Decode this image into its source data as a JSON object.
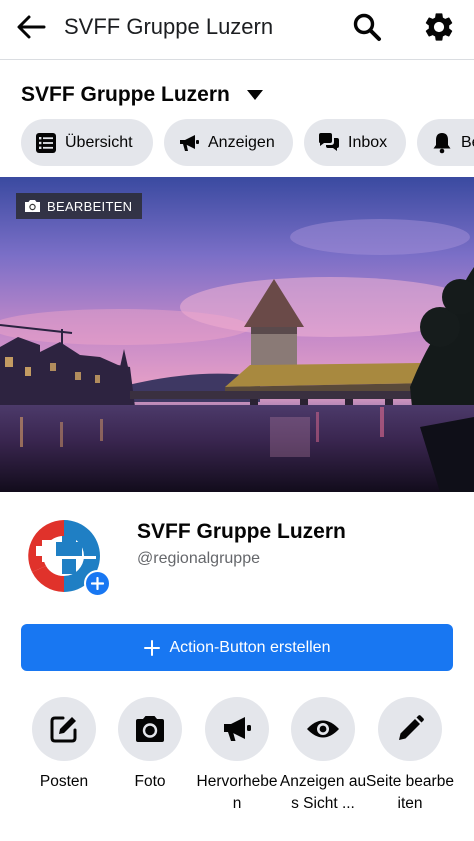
{
  "header": {
    "title": "SVFF Gruppe Luzern",
    "back_icon": "back-arrow-icon",
    "search_icon": "search-icon",
    "settings_icon": "gear-icon"
  },
  "page_switcher": {
    "name": "SVFF Gruppe Luzern",
    "icon": "caret-down-icon"
  },
  "tabs": [
    {
      "label": "Übersicht",
      "icon": "list-icon"
    },
    {
      "label": "Anzeigen",
      "icon": "megaphone-icon"
    },
    {
      "label": "Inbox",
      "icon": "chat-bubbles-icon"
    },
    {
      "label": "Be",
      "icon": "bell-icon"
    }
  ],
  "cover": {
    "edit_label": "BEARBEITEN",
    "edit_icon": "camera-icon"
  },
  "profile": {
    "name": "SVFF Gruppe Luzern",
    "handle": "@regionalgruppe",
    "add_icon": "plus-icon"
  },
  "action_button": {
    "label": "Action-Button erstellen",
    "icon": "plus-icon"
  },
  "quick_actions": [
    {
      "label": "Posten",
      "icon": "compose-icon"
    },
    {
      "label": "Foto",
      "icon": "camera-icon"
    },
    {
      "label": "Hervorheben",
      "icon": "megaphone-icon"
    },
    {
      "label": "Anzeigen aus Sicht ...",
      "icon": "eye-icon"
    },
    {
      "label": "Seite bearbeiten",
      "icon": "pencil-icon"
    }
  ],
  "colors": {
    "accent": "#1877f2",
    "chip_bg": "#e4e6eb",
    "secondary_text": "#65676b",
    "logo_red": "#e0322b",
    "logo_blue": "#1f7fc4"
  }
}
